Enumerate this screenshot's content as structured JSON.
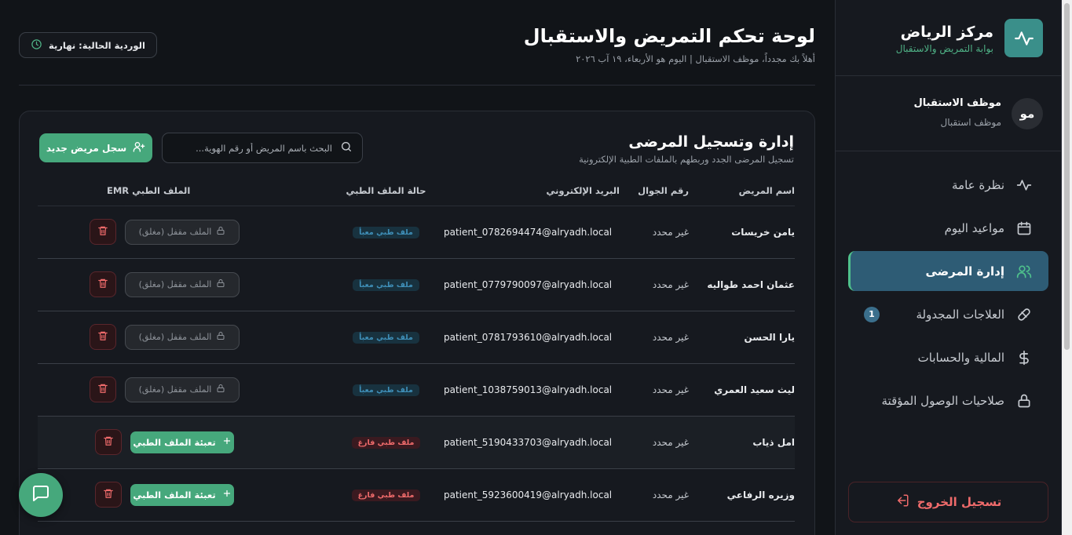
{
  "sidebar": {
    "brand_title": "مركز الرياض",
    "brand_subtitle": "بوابة التمريض والاستقبال",
    "user_initials": "مو",
    "user_name": "موظف الاستقبال",
    "user_role": "موظف استقبال",
    "nav": [
      {
        "label": "نظرة عامة",
        "icon": "activity-icon",
        "active": false
      },
      {
        "label": "مواعيد اليوم",
        "icon": "calendar-icon",
        "active": false
      },
      {
        "label": "إدارة المرضى",
        "icon": "users-icon",
        "active": true
      },
      {
        "label": "العلاجات المجدولة",
        "icon": "pill-icon",
        "active": false,
        "badge": "1"
      },
      {
        "label": "المالية والحسابات",
        "icon": "dollar-icon",
        "active": false
      },
      {
        "label": "صلاحيات الوصول المؤقتة",
        "icon": "lock-icon",
        "active": false
      }
    ],
    "logout_label": "تسجيل الخروج"
  },
  "header": {
    "title": "لوحة تحكم التمريض والاستقبال",
    "subtitle": "أهلاً بك مجدداً، موظف الاستقبال | اليوم هو الأربعاء، ١٩ آب ٢٠٢٦",
    "shift_label": "الوردية الحالية: نهارية"
  },
  "patients": {
    "title": "إدارة وتسجيل المرضى",
    "subtitle": "تسجيل المرضى الجدد وربطهم بالملفات الطبية الإلكترونية",
    "search_placeholder": "البحث باسم المريض أو رقم الهوية...",
    "add_label": "سجل مريض جديد",
    "columns": {
      "name": "اسم المريض",
      "phone": "رقم الجوال",
      "email": "البريد الإلكتروني",
      "status": "حالة الملف الطبي",
      "emr": "الملف الطبي EMR"
    },
    "rows": [
      {
        "name": "يامن خريسات",
        "phone": "غير محدد",
        "email": "patient_0782694474@alryadh.local",
        "status": "ملف طبي معبأ",
        "status_type": "filled",
        "action": "الملف مقفل (مغلق)",
        "action_type": "locked"
      },
      {
        "name": "عثمان احمد طواليه",
        "phone": "غير محدد",
        "email": "patient_0779790097@alryadh.local",
        "status": "ملف طبي معبأ",
        "status_type": "filled",
        "action": "الملف مقفل (مغلق)",
        "action_type": "locked"
      },
      {
        "name": "يارا الحسن",
        "phone": "غير محدد",
        "email": "patient_0781793610@alryadh.local",
        "status": "ملف طبي معبأ",
        "status_type": "filled",
        "action": "الملف مقفل (مغلق)",
        "action_type": "locked"
      },
      {
        "name": "ليث سعيد العمري",
        "phone": "غير محدد",
        "email": "patient_1038759013@alryadh.local",
        "status": "ملف طبي معبأ",
        "status_type": "filled",
        "action": "الملف مقفل (مغلق)",
        "action_type": "locked"
      },
      {
        "name": "امل ذياب",
        "phone": "غير محدد",
        "email": "patient_5190433703@alryadh.local",
        "status": "ملف طبي فارغ",
        "status_type": "empty",
        "action": "تعبئة الملف الطبي",
        "action_type": "fill"
      },
      {
        "name": "وزيره الرفاعي",
        "phone": "غير محدد",
        "email": "patient_5923600419@alryadh.local",
        "status": "ملف طبي فارغ",
        "status_type": "empty",
        "action": "تعبئة الملف الطبي",
        "action_type": "fill"
      }
    ]
  },
  "colors": {
    "accent": "#46a87c",
    "active_nav": "#2e5c75",
    "danger": "#ef6b6b",
    "background": "#111418"
  }
}
